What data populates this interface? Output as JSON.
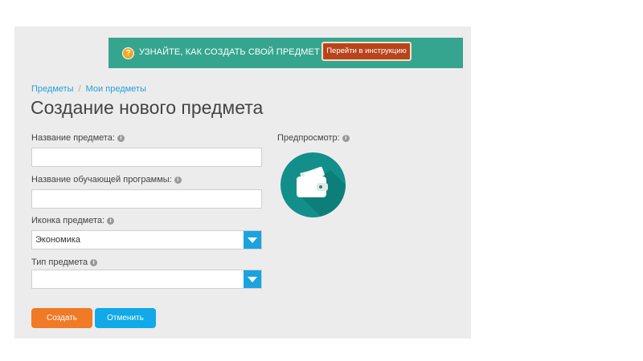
{
  "banner": {
    "question_mark": "?",
    "text": "УЗНАЙТЕ, КАК СОЗДАТЬ СВОЙ ПРЕДМЕТ →",
    "button_label": "Перейти в инструкцию"
  },
  "breadcrumb": {
    "items": [
      {
        "label": "Предметы"
      },
      {
        "label": "Мои предметы"
      }
    ],
    "separator": "/"
  },
  "page_title": "Создание нового предмета",
  "form": {
    "subject_name": {
      "label": "Название предмета:",
      "value": ""
    },
    "program_name": {
      "label": "Название обучающей программы:",
      "value": ""
    },
    "subject_icon": {
      "label": "Иконка предмета:",
      "selected": "Экономика"
    },
    "subject_type": {
      "label": "Тип предмета",
      "selected": ""
    }
  },
  "info_glyph": "i",
  "preview": {
    "label": "Предпросмотр:",
    "icon": "wallet-icon"
  },
  "buttons": {
    "create": "Создать",
    "cancel": "Отменить"
  },
  "colors": {
    "banner_bg": "#36a58f",
    "banner_button": "#b9441c",
    "link": "#2a9fd6",
    "select_arrow": "#1aa3df",
    "preview_bg": "#138f8b",
    "create_button": "#f07a26",
    "cancel_button": "#11a9e8"
  }
}
